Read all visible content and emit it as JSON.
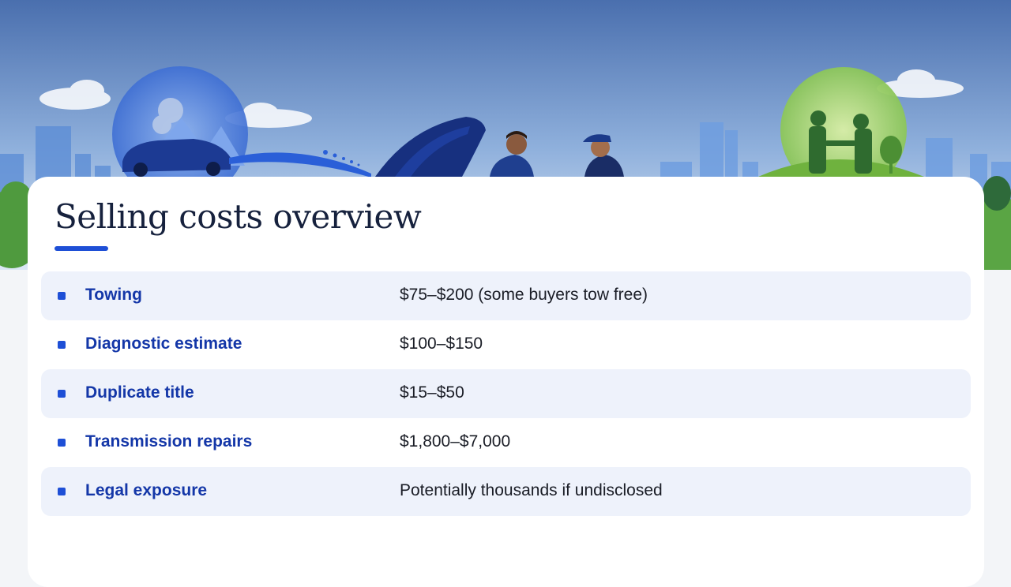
{
  "slide": {
    "title": "Selling costs overview"
  },
  "costs": [
    {
      "label": "Towing",
      "value": "$75–$200 (some buyers tow free)"
    },
    {
      "label": "Diagnostic estimate",
      "value": "$100–$150"
    },
    {
      "label": "Duplicate title",
      "value": "$15–$50"
    },
    {
      "label": "Transmission repairs",
      "value": "$1,800–$7,000"
    },
    {
      "label": "Legal exposure",
      "value": "Potentially thousands if undisclosed"
    }
  ],
  "colors": {
    "accent": "#1e4fd6",
    "label": "#1437a8",
    "row_shade": "#eef2fb",
    "title": "#16213d"
  }
}
